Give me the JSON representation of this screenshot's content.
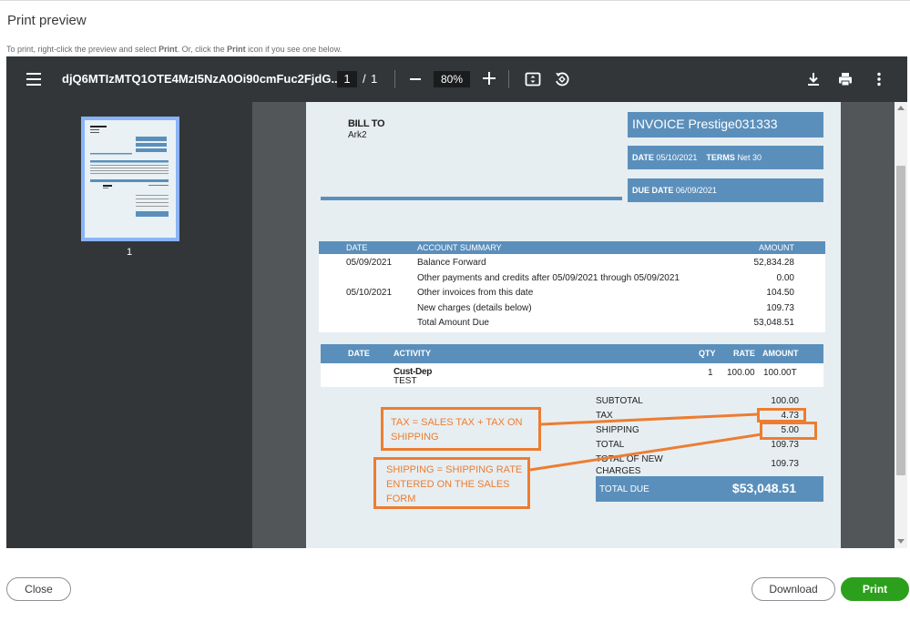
{
  "dialog": {
    "title": "Print preview",
    "hint_pre": "To print, right-click the preview and select ",
    "hint_b1": "Print",
    "hint_mid": ". Or, click the ",
    "hint_b2": "Print",
    "hint_post": " icon if you see one below."
  },
  "toolbar": {
    "filename": "djQ6MTIzMTQ1OTE4MzI5NzA0Oi90cmFuc2FjdG...",
    "current_page": "1",
    "page_sep": "/",
    "total_pages": "1",
    "zoom": "80%"
  },
  "thumbnails": [
    {
      "label": "1"
    }
  ],
  "invoice": {
    "bill_to_label": "BILL TO",
    "bill_to_name": "Ark2",
    "title": "INVOICE Prestige031333",
    "date_label": "DATE",
    "date_value": "05/10/2021",
    "terms_label": "TERMS",
    "terms_value": "Net 30",
    "due_label": "DUE DATE",
    "due_value": "06/09/2021",
    "summary_headers": {
      "date": "DATE",
      "account": "ACCOUNT SUMMARY",
      "amount": "AMOUNT"
    },
    "summary_rows": [
      {
        "date": "05/09/2021",
        "desc": "Balance Forward",
        "amount": "52,834.28"
      },
      {
        "date": "",
        "desc": "Other payments and credits after 05/09/2021 through 05/09/2021",
        "amount": "0.00"
      },
      {
        "date": "05/10/2021",
        "desc": "Other invoices from this date",
        "amount": "104.50"
      },
      {
        "date": "",
        "desc": "New charges (details below)",
        "amount": "109.73"
      },
      {
        "date": "",
        "desc": "Total Amount Due",
        "amount": "53,048.51"
      }
    ],
    "activity_headers": {
      "date": "DATE",
      "activity": "ACTIVITY",
      "qty": "QTY",
      "rate": "RATE",
      "amount": "AMOUNT"
    },
    "activity_rows": [
      {
        "activity": "Cust-Dep",
        "sub": "TEST",
        "qty": "1",
        "rate": "100.00",
        "amount": "100.00T"
      }
    ],
    "totals": [
      {
        "label": "SUBTOTAL",
        "value": "100.00"
      },
      {
        "label": "TAX",
        "value": "4.73"
      },
      {
        "label": "SHIPPING",
        "value": "5.00"
      },
      {
        "label": "TOTAL",
        "value": "109.73"
      },
      {
        "label": "TOTAL OF NEW CHARGES",
        "value": "109.73"
      }
    ],
    "total_due_label": "TOTAL DUE",
    "total_due_value": "$53,048.51"
  },
  "annotations": {
    "tax_note": "TAX = SALES TAX + TAX ON SHIPPING",
    "shipping_note": "SHIPPING = SHIPPING RATE ENTERED ON THE SALES FORM",
    "color": "#ed7d31"
  },
  "buttons": {
    "close": "Close",
    "download": "Download",
    "print": "Print"
  },
  "colors": {
    "accent_blue": "#5b8fbb",
    "print_green": "#2ca01c",
    "viewer_bg": "#525659",
    "toolbar_bg": "#323639"
  }
}
